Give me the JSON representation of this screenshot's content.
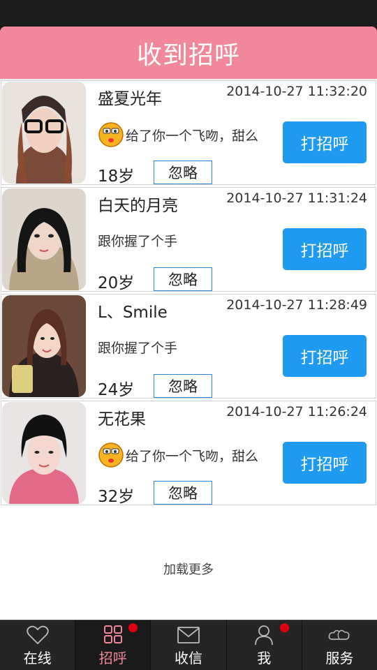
{
  "header": {
    "title": "收到招呼"
  },
  "items": [
    {
      "name": "盛夏光年",
      "time": "2014-10-27 11:32:20",
      "message": "给了你一个飞吻，甜么",
      "has_emoji": true,
      "age": "18岁",
      "ignore_label": "忽略",
      "greet_label": "打招呼"
    },
    {
      "name": "白天的月亮",
      "time": "2014-10-27 11:31:24",
      "message": "跟你握了个手",
      "has_emoji": false,
      "age": "20岁",
      "ignore_label": "忽略",
      "greet_label": "打招呼"
    },
    {
      "name": "L、Smile",
      "time": "2014-10-27 11:28:49",
      "message": "跟你握了个手",
      "has_emoji": false,
      "age": "24岁",
      "ignore_label": "忽略",
      "greet_label": "打招呼"
    },
    {
      "name": "无花果",
      "time": "2014-10-27 11:26:24",
      "message": "给了你一个飞吻，甜么",
      "has_emoji": true,
      "age": "32岁",
      "ignore_label": "忽略",
      "greet_label": "打招呼"
    }
  ],
  "load_more": "加载更多",
  "tabs": [
    {
      "label": "在线",
      "icon": "heart-icon",
      "active": false,
      "badge": false
    },
    {
      "label": "招呼",
      "icon": "grid-icon",
      "active": true,
      "badge": true
    },
    {
      "label": "收信",
      "icon": "envelope-icon",
      "active": false,
      "badge": false
    },
    {
      "label": "我",
      "icon": "user-icon",
      "active": false,
      "badge": true
    },
    {
      "label": "服务",
      "icon": "clouds-icon",
      "active": false,
      "badge": false
    }
  ],
  "colors": {
    "header": "#f1879a",
    "button": "#1e9af0",
    "tabbar": "#252525",
    "badge": "#e00010"
  }
}
